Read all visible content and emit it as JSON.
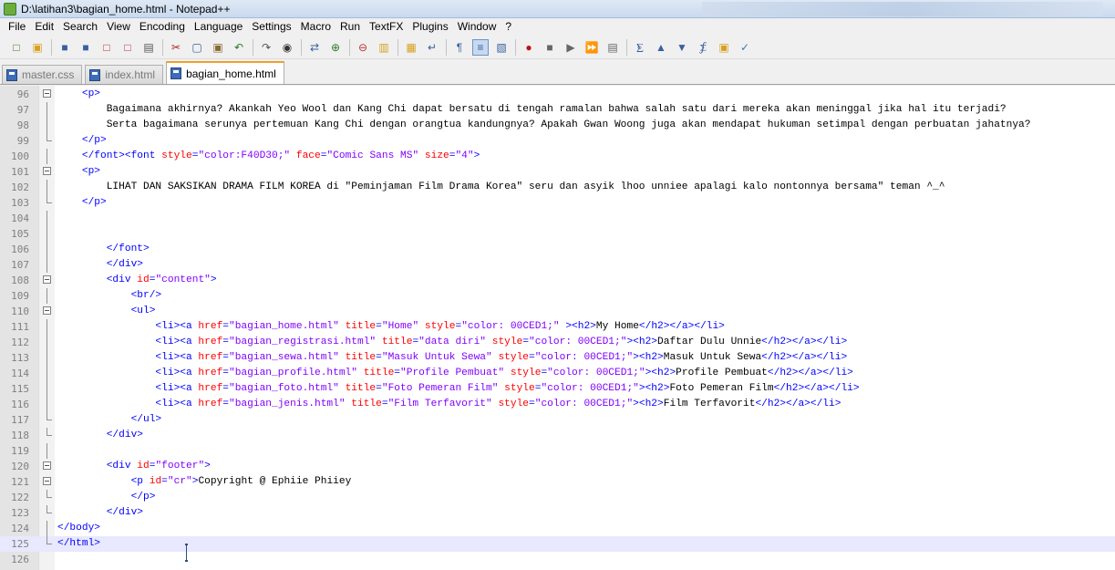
{
  "window": {
    "title": "D:\\latihan3\\bagian_home.html - Notepad++"
  },
  "menu": [
    "File",
    "Edit",
    "Search",
    "View",
    "Encoding",
    "Language",
    "Settings",
    "Macro",
    "Run",
    "TextFX",
    "Plugins",
    "Window",
    "?"
  ],
  "toolbar": {
    "icons": [
      "new-file",
      "open-file",
      "save",
      "save-all",
      "close",
      "close-all",
      "print",
      "cut",
      "copy",
      "paste",
      "undo",
      "redo",
      "find",
      "replace",
      "zoom-in",
      "zoom-out",
      "sync-vertical",
      "sync-horizontal",
      "word-wrap",
      "show-all-chars",
      "indent-guide",
      "doc-map",
      "record-macro",
      "stop-macro",
      "play-macro",
      "run-macro-multiple",
      "save-macro",
      "fold-all",
      "move-up",
      "move-down",
      "unfold-all",
      "open-folder",
      "spell-check"
    ]
  },
  "tabs": [
    {
      "label": "master.css",
      "active": false
    },
    {
      "label": "index.html",
      "active": false
    },
    {
      "label": "bagian_home.html",
      "active": true
    }
  ],
  "editor": {
    "current_line": 125,
    "lines": [
      {
        "n": "96",
        "f": "minus",
        "i": "    ",
        "p": [
          [
            "t",
            "<p>"
          ]
        ]
      },
      {
        "n": "97",
        "f": "vline",
        "i": "        ",
        "p": [
          [
            "x",
            "Bagaimana akhirnya? Akankah Yeo Wool dan Kang Chi dapat bersatu di tengah ramalan bahwa salah satu dari mereka akan meninggal jika hal itu terjadi?"
          ]
        ]
      },
      {
        "n": "98",
        "f": "vline",
        "i": "        ",
        "p": [
          [
            "x",
            "Serta bagaimana serunya pertemuan Kang Chi dengan orangtua kandungnya? Apakah Gwan Woong juga akan mendapat hukuman setimpal dengan perbuatan jahatnya?"
          ]
        ]
      },
      {
        "n": "99",
        "f": "end",
        "i": "    ",
        "p": [
          [
            "t",
            "</p>"
          ]
        ]
      },
      {
        "n": "100",
        "f": "vline",
        "i": "    ",
        "p": [
          [
            "t",
            "</font><font "
          ],
          [
            "a",
            "style"
          ],
          [
            "t",
            "="
          ],
          [
            "v",
            "\"color:F40D30;\""
          ],
          [
            "t",
            " "
          ],
          [
            "a",
            "face"
          ],
          [
            "t",
            "="
          ],
          [
            "v",
            "\"Comic Sans MS\""
          ],
          [
            "t",
            " "
          ],
          [
            "a",
            "size"
          ],
          [
            "t",
            "="
          ],
          [
            "v",
            "\"4\""
          ],
          [
            "t",
            ">"
          ]
        ]
      },
      {
        "n": "101",
        "f": "minus",
        "i": "    ",
        "p": [
          [
            "t",
            "<p>"
          ]
        ]
      },
      {
        "n": "102",
        "f": "vline",
        "i": "        ",
        "p": [
          [
            "x",
            "LIHAT DAN SAKSIKAN DRAMA FILM KOREA di \"Peminjaman Film Drama Korea\" seru dan asyik lhoo unniee apalagi kalo nontonnya bersama\" teman ^_^"
          ]
        ]
      },
      {
        "n": "103",
        "f": "end",
        "i": "    ",
        "p": [
          [
            "t",
            "</p>"
          ]
        ]
      },
      {
        "n": "104",
        "f": "vline",
        "i": "",
        "p": []
      },
      {
        "n": "105",
        "f": "vline",
        "i": "",
        "p": []
      },
      {
        "n": "106",
        "f": "vline",
        "i": "        ",
        "p": [
          [
            "t",
            "</font>"
          ]
        ]
      },
      {
        "n": "107",
        "f": "vline",
        "i": "        ",
        "p": [
          [
            "t",
            "</div>"
          ]
        ]
      },
      {
        "n": "108",
        "f": "minus",
        "i": "        ",
        "p": [
          [
            "t",
            "<div "
          ],
          [
            "a",
            "id"
          ],
          [
            "t",
            "="
          ],
          [
            "v",
            "\"content\""
          ],
          [
            "t",
            ">"
          ]
        ]
      },
      {
        "n": "109",
        "f": "vline",
        "i": "            ",
        "p": [
          [
            "t",
            "<br/>"
          ]
        ]
      },
      {
        "n": "110",
        "f": "minus",
        "i": "            ",
        "p": [
          [
            "t",
            "<ul>"
          ]
        ]
      },
      {
        "n": "111",
        "f": "vline",
        "i": "                ",
        "p": [
          [
            "t",
            "<li><a "
          ],
          [
            "a",
            "href"
          ],
          [
            "t",
            "="
          ],
          [
            "v",
            "\"bagian_home.html\""
          ],
          [
            "t",
            " "
          ],
          [
            "a",
            "title"
          ],
          [
            "t",
            "="
          ],
          [
            "v",
            "\"Home\""
          ],
          [
            "t",
            " "
          ],
          [
            "a",
            "style"
          ],
          [
            "t",
            "="
          ],
          [
            "v",
            "\"color: 00CED1;\""
          ],
          [
            "t",
            " ><h2>"
          ],
          [
            "x",
            "My Home"
          ],
          [
            "t",
            "</h2></a></li>"
          ]
        ]
      },
      {
        "n": "112",
        "f": "vline",
        "i": "                ",
        "p": [
          [
            "t",
            "<li><a "
          ],
          [
            "a",
            "href"
          ],
          [
            "t",
            "="
          ],
          [
            "v",
            "\"bagian_registrasi.html\""
          ],
          [
            "t",
            " "
          ],
          [
            "a",
            "title"
          ],
          [
            "t",
            "="
          ],
          [
            "v",
            "\"data diri\""
          ],
          [
            "t",
            " "
          ],
          [
            "a",
            "style"
          ],
          [
            "t",
            "="
          ],
          [
            "v",
            "\"color: 00CED1;\""
          ],
          [
            "t",
            "><h2>"
          ],
          [
            "x",
            "Daftar Dulu Unnie"
          ],
          [
            "t",
            "</h2></a></li>"
          ]
        ]
      },
      {
        "n": "113",
        "f": "vline",
        "i": "                ",
        "p": [
          [
            "t",
            "<li><a "
          ],
          [
            "a",
            "href"
          ],
          [
            "t",
            "="
          ],
          [
            "v",
            "\"bagian_sewa.html\""
          ],
          [
            "t",
            " "
          ],
          [
            "a",
            "title"
          ],
          [
            "t",
            "="
          ],
          [
            "v",
            "\"Masuk Untuk Sewa\""
          ],
          [
            "t",
            " "
          ],
          [
            "a",
            "style"
          ],
          [
            "t",
            "="
          ],
          [
            "v",
            "\"color: 00CED1;\""
          ],
          [
            "t",
            "><h2>"
          ],
          [
            "x",
            "Masuk Untuk Sewa"
          ],
          [
            "t",
            "</h2></a></li>"
          ]
        ]
      },
      {
        "n": "114",
        "f": "vline",
        "i": "                ",
        "p": [
          [
            "t",
            "<li><a "
          ],
          [
            "a",
            "href"
          ],
          [
            "t",
            "="
          ],
          [
            "v",
            "\"bagian_profile.html\""
          ],
          [
            "t",
            " "
          ],
          [
            "a",
            "title"
          ],
          [
            "t",
            "="
          ],
          [
            "v",
            "\"Profile Pembuat\""
          ],
          [
            "t",
            " "
          ],
          [
            "a",
            "style"
          ],
          [
            "t",
            "="
          ],
          [
            "v",
            "\"color: 00CED1;\""
          ],
          [
            "t",
            "><h2>"
          ],
          [
            "x",
            "Profile Pembuat"
          ],
          [
            "t",
            "</h2></a></li>"
          ]
        ]
      },
      {
        "n": "115",
        "f": "vline",
        "i": "                ",
        "p": [
          [
            "t",
            "<li><a "
          ],
          [
            "a",
            "href"
          ],
          [
            "t",
            "="
          ],
          [
            "v",
            "\"bagian_foto.html\""
          ],
          [
            "t",
            " "
          ],
          [
            "a",
            "title"
          ],
          [
            "t",
            "="
          ],
          [
            "v",
            "\"Foto Pemeran Film\""
          ],
          [
            "t",
            " "
          ],
          [
            "a",
            "style"
          ],
          [
            "t",
            "="
          ],
          [
            "v",
            "\"color: 00CED1;\""
          ],
          [
            "t",
            "><h2>"
          ],
          [
            "x",
            "Foto Pemeran Film"
          ],
          [
            "t",
            "</h2></a></li>"
          ]
        ]
      },
      {
        "n": "116",
        "f": "vline",
        "i": "                ",
        "p": [
          [
            "t",
            "<li><a "
          ],
          [
            "a",
            "href"
          ],
          [
            "t",
            "="
          ],
          [
            "v",
            "\"bagian_jenis.html\""
          ],
          [
            "t",
            " "
          ],
          [
            "a",
            "title"
          ],
          [
            "t",
            "="
          ],
          [
            "v",
            "\"Film Terfavorit\""
          ],
          [
            "t",
            " "
          ],
          [
            "a",
            "style"
          ],
          [
            "t",
            "="
          ],
          [
            "v",
            "\"color: 00CED1;\""
          ],
          [
            "t",
            "><h2>"
          ],
          [
            "x",
            "Film Terfavorit"
          ],
          [
            "t",
            "</h2></a></li>"
          ]
        ]
      },
      {
        "n": "117",
        "f": "end",
        "i": "            ",
        "p": [
          [
            "t",
            "</ul>"
          ]
        ]
      },
      {
        "n": "118",
        "f": "end",
        "i": "        ",
        "p": [
          [
            "t",
            "</div>"
          ]
        ]
      },
      {
        "n": "119",
        "f": "vline",
        "i": "",
        "p": []
      },
      {
        "n": "120",
        "f": "minus",
        "i": "        ",
        "p": [
          [
            "t",
            "<div "
          ],
          [
            "a",
            "id"
          ],
          [
            "t",
            "="
          ],
          [
            "v",
            "\"footer\""
          ],
          [
            "t",
            ">"
          ]
        ]
      },
      {
        "n": "121",
        "f": "minus",
        "i": "            ",
        "p": [
          [
            "t",
            "<p "
          ],
          [
            "a",
            "id"
          ],
          [
            "t",
            "="
          ],
          [
            "v",
            "\"cr\""
          ],
          [
            "t",
            ">"
          ],
          [
            "x",
            "Copyright @ Ephiie Phiiey"
          ]
        ]
      },
      {
        "n": "122",
        "f": "end",
        "i": "            ",
        "p": [
          [
            "t",
            "</p>"
          ]
        ]
      },
      {
        "n": "123",
        "f": "end",
        "i": "        ",
        "p": [
          [
            "t",
            "</div>"
          ]
        ]
      },
      {
        "n": "124",
        "f": "vline",
        "i": "",
        "p": [
          [
            "t",
            "</body>"
          ]
        ]
      },
      {
        "n": "125",
        "f": "end",
        "i": "",
        "p": [
          [
            "t",
            "</html>"
          ]
        ]
      },
      {
        "n": "126",
        "f": "none",
        "i": "",
        "p": []
      }
    ]
  }
}
